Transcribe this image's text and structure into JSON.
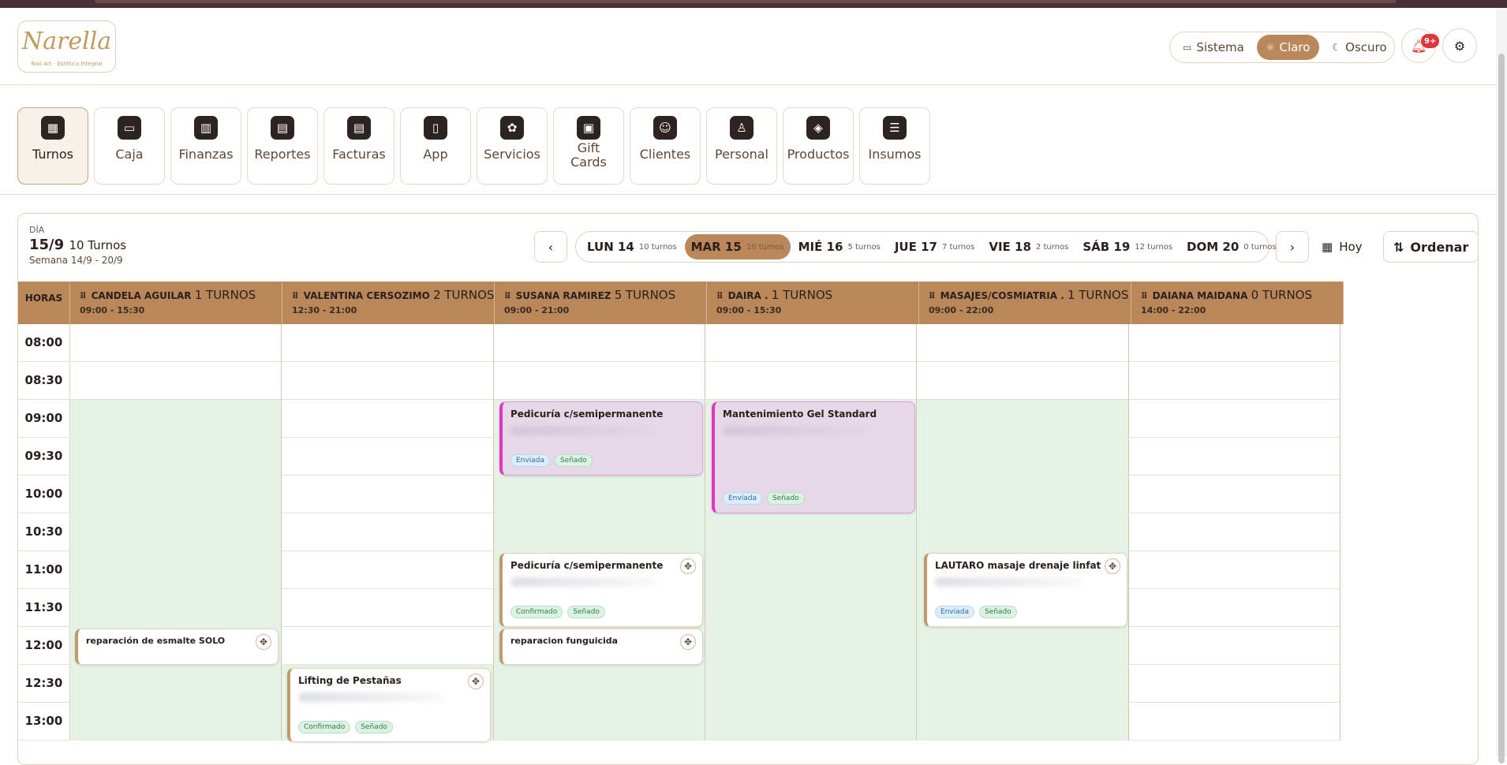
{
  "header": {
    "logo": {
      "brand": "Narella",
      "tagline": "Nail Art · Estética Integral"
    },
    "theme": {
      "options": [
        "Sistema",
        "Claro",
        "Oscuro"
      ],
      "active": "Claro"
    },
    "notifications_badge": "9+"
  },
  "modules": [
    {
      "label": "Turnos",
      "icon": "calendar-icon",
      "glyph": "▦"
    },
    {
      "label": "Caja",
      "icon": "wallet-icon",
      "glyph": "▭"
    },
    {
      "label": "Finanzas",
      "icon": "bar-chart-icon",
      "glyph": "▥"
    },
    {
      "label": "Reportes",
      "icon": "report-icon",
      "glyph": "▤"
    },
    {
      "label": "Facturas",
      "icon": "invoice-icon",
      "glyph": "▤"
    },
    {
      "label": "App",
      "icon": "phone-icon",
      "glyph": "▯"
    },
    {
      "label": "Servicios",
      "icon": "service-icon",
      "glyph": "✿"
    },
    {
      "label": "Gift Cards",
      "icon": "gift-icon",
      "glyph": "▣"
    },
    {
      "label": "Clientes",
      "icon": "clients-icon",
      "glyph": "☺"
    },
    {
      "label": "Personal",
      "icon": "person-icon",
      "glyph": "♙"
    },
    {
      "label": "Productos",
      "icon": "box-icon",
      "glyph": "◈"
    },
    {
      "label": "Insumos",
      "icon": "supplies-icon",
      "glyph": "☰"
    }
  ],
  "day": {
    "label": "DÍA",
    "date": "15/9",
    "count": "10 Turnos",
    "week": "Semana 14/9 - 20/9"
  },
  "week_days": [
    {
      "name": "LUN 14",
      "count": "10 turnos"
    },
    {
      "name": "MAR 15",
      "count": "10 turnos"
    },
    {
      "name": "MIÉ 16",
      "count": "5 turnos"
    },
    {
      "name": "JUE 17",
      "count": "7 turnos"
    },
    {
      "name": "VIE 18",
      "count": "2 turnos"
    },
    {
      "name": "SÁB 19",
      "count": "12 turnos"
    },
    {
      "name": "DOM 20",
      "count": "0 turnos"
    }
  ],
  "active_day": "MAR 15",
  "actions": {
    "today": "Hoy",
    "order": "Ordenar"
  },
  "grid": {
    "horas_label": "HORAS",
    "times": [
      "08:00",
      "08:30",
      "09:00",
      "09:30",
      "10:00",
      "10:30",
      "11:00",
      "11:30",
      "12:00",
      "12:30",
      "13:00"
    ],
    "staff": [
      {
        "name": "CANDELA AGUILAR",
        "count": "1 TURNOS",
        "hours": "09:00 - 15:30"
      },
      {
        "name": "VALENTINA CERSOZIMO",
        "count": "2 TURNOS",
        "hours": "12:30 - 21:00"
      },
      {
        "name": "SUSANA RAMIREZ",
        "count": "5 TURNOS",
        "hours": "09:00 - 21:00"
      },
      {
        "name": "DAIRA .",
        "count": "1 TURNOS",
        "hours": "09:00 - 15:30"
      },
      {
        "name": "MASAJES/COSMIATRIA .",
        "count": "1 TURNOS",
        "hours": "09:00 - 22:00"
      },
      {
        "name": "DAIANA MAIDANA",
        "count": "0 TURNOS",
        "hours": "14:00 - 22:00"
      }
    ]
  },
  "appointments": [
    {
      "title": "Pedicuría c/semipermanente",
      "tags": [
        "Enviada",
        "Señado"
      ]
    },
    {
      "title": "Mantenimiento Gel Standard",
      "tags": [
        "Enviada",
        "Señado"
      ]
    },
    {
      "title": "Pedicuría c/semipermanente",
      "tags": [
        "Confirmado",
        "Señado"
      ]
    },
    {
      "title": "LAUTARO masaje drenaje linfatico ...",
      "tags": [
        "Enviada",
        "Señado"
      ]
    },
    {
      "title": "reparación de esmalte SOLO",
      "tags": []
    },
    {
      "title": "reparacion funguicida",
      "tags": []
    },
    {
      "title": "Lifting de Pestañas",
      "tags": [
        "Confirmado",
        "Señado"
      ]
    }
  ]
}
